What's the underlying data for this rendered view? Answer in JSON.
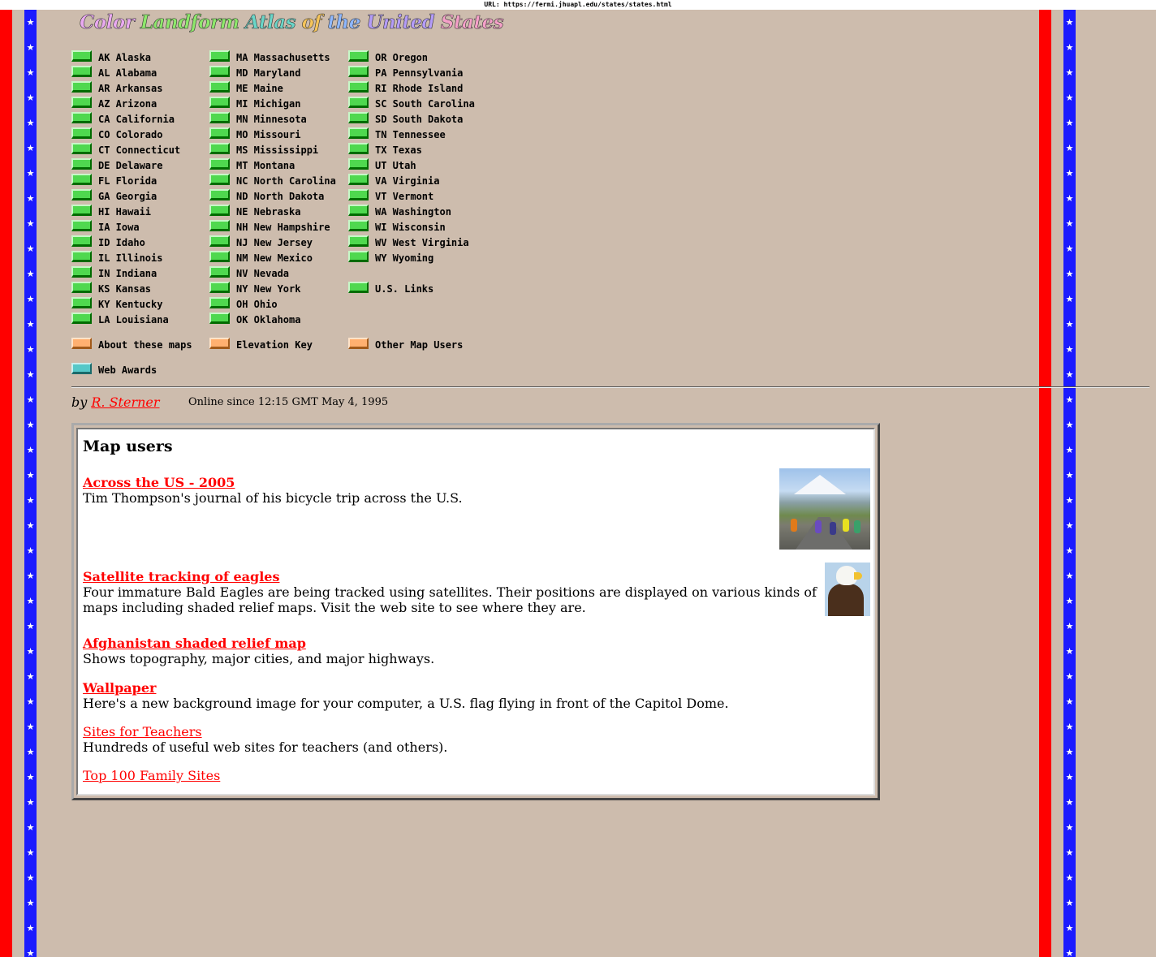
{
  "url_bar": "URL: https://fermi.jhuapl.edu/states/states.html",
  "title": {
    "words": [
      "Color",
      "Landform",
      "Atlas",
      "of",
      "the",
      "United",
      "States"
    ],
    "colors": [
      "#e9a9f0",
      "#8ee86b",
      "#6ad6c8",
      "#f5c45a",
      "#8fb8ff",
      "#b49cf8",
      "#f5a0c8"
    ]
  },
  "states_col1": [
    "AK Alaska",
    "AL Alabama",
    "AR Arkansas",
    "AZ Arizona",
    "CA California",
    "CO Colorado",
    "CT Connecticut",
    "DE Delaware",
    "FL Florida",
    "GA Georgia",
    "HI Hawaii",
    "IA Iowa",
    "ID Idaho",
    "IL Illinois",
    "IN Indiana",
    "KS Kansas",
    "KY Kentucky",
    "LA Louisiana"
  ],
  "states_col2": [
    "MA Massachusetts",
    "MD Maryland",
    "ME Maine",
    "MI Michigan",
    "MN Minnesota",
    "MO Missouri",
    "MS Mississippi",
    "MT Montana",
    "NC North Carolina",
    "ND North Dakota",
    "NE Nebraska",
    "NH New Hampshire",
    "NJ New Jersey",
    "NM New Mexico",
    "NV Nevada",
    "NY New York",
    "OH Ohio",
    "OK Oklahoma"
  ],
  "states_col3": [
    "OR Oregon",
    "PA Pennsylvania",
    "RI Rhode Island",
    "SC South Carolina",
    "SD South Dakota",
    "TN Tennessee",
    "TX Texas",
    "UT Utah",
    "VA Virginia",
    "VT Vermont",
    "WA Washington",
    "WI Wisconsin",
    "WV West Virginia",
    "WY Wyoming"
  ],
  "us_links": "U.S. Links",
  "about": "About these maps",
  "elevation": "Elevation Key",
  "other_users": "Other Map Users",
  "web_awards": "Web Awards",
  "byline_prefix": "by",
  "author": "R. Sterner",
  "online_since": "Online since 12:15 GMT May 4, 1995",
  "panel": {
    "heading": "Map users",
    "entries": [
      {
        "title": "Across the US - 2005",
        "desc": "Tim Thompson's journal of his bicycle trip across the U.S."
      },
      {
        "title": "Satellite tracking of eagles",
        "desc": "Four immature Bald Eagles are being tracked using satellites. Their positions are displayed on various kinds of maps including shaded relief maps. Visit the web site to see where they are."
      },
      {
        "title": "Afghanistan shaded relief map",
        "desc": "Shows topography, major cities, and major highways."
      },
      {
        "title": "Wallpaper",
        "desc": "Here's a new background image for your computer, a U.S. flag flying in front of the Capitol Dome."
      },
      {
        "title": "Sites for Teachers",
        "desc": "Hundreds of useful web sites for teachers (and others)."
      },
      {
        "title": "Top 100 Family Sites",
        "desc": ""
      }
    ]
  }
}
